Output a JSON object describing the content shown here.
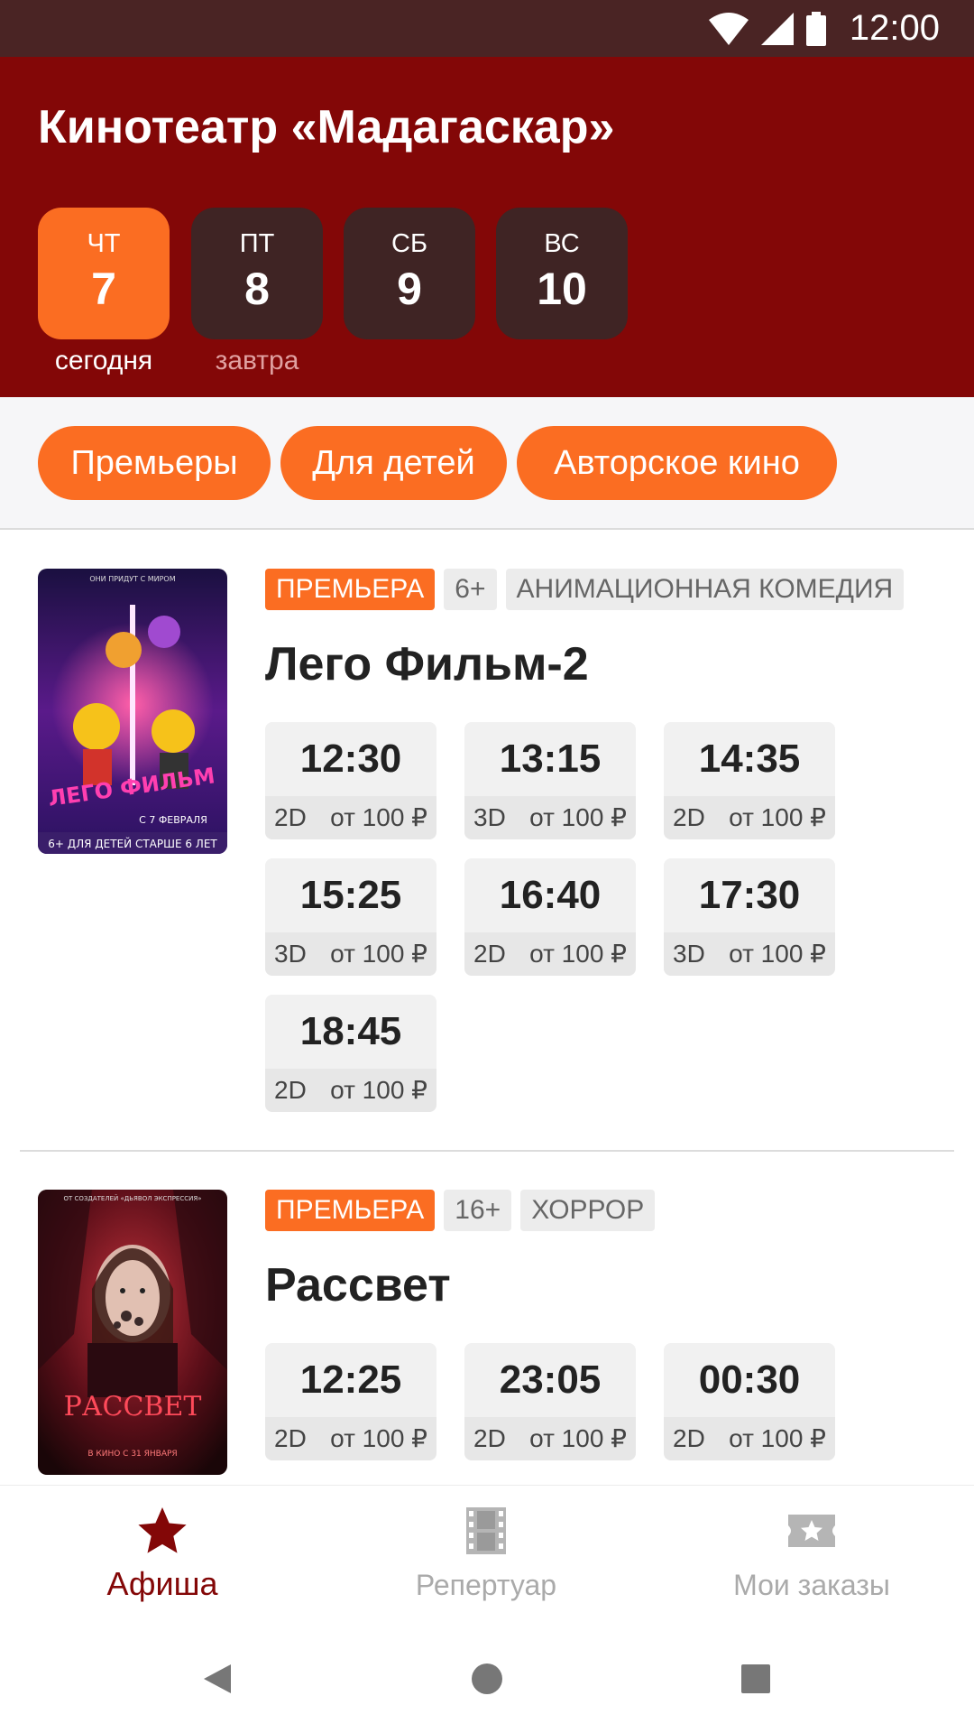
{
  "status_bar": {
    "time": "12:00",
    "icons": [
      "wifi-icon",
      "signal-icon",
      "battery-icon"
    ]
  },
  "header": {
    "title": "Кинотеатр «Мадагаскар»"
  },
  "days": [
    {
      "dow": "ЧТ",
      "num": "7",
      "caption": "сегодня",
      "active": true
    },
    {
      "dow": "ПТ",
      "num": "8",
      "caption": "завтра",
      "active": false
    },
    {
      "dow": "СБ",
      "num": "9",
      "caption": "",
      "active": false
    },
    {
      "dow": "ВС",
      "num": "10",
      "caption": "",
      "active": false
    }
  ],
  "filters": [
    "Премьеры",
    "Для детей",
    "Авторское кино"
  ],
  "movies": [
    {
      "tags": [
        "ПРЕМЬЕРА",
        "6+",
        "АНИМАЦИОННАЯ КОМЕДИЯ"
      ],
      "title": "Лего Фильм-2",
      "poster": {
        "top_text": "ОНИ ПРИДУТ С МИРОМ",
        "main_text": "ЛЕГО ФИЛЬМ",
        "date_text": "С 7 ФЕВРАЛЯ",
        "footer_text": "6+ ДЛЯ ДЕТЕЙ СТАРШЕ 6 ЛЕТ"
      },
      "sessions": [
        {
          "time": "12:30",
          "format": "2D",
          "price": "от 100 ₽"
        },
        {
          "time": "13:15",
          "format": "3D",
          "price": "от 100 ₽"
        },
        {
          "time": "14:35",
          "format": "2D",
          "price": "от 100 ₽"
        },
        {
          "time": "15:25",
          "format": "3D",
          "price": "от 100 ₽"
        },
        {
          "time": "16:40",
          "format": "2D",
          "price": "от 100 ₽"
        },
        {
          "time": "17:30",
          "format": "3D",
          "price": "от 100 ₽"
        },
        {
          "time": "18:45",
          "format": "2D",
          "price": "от 100 ₽"
        }
      ]
    },
    {
      "tags": [
        "ПРЕМЬЕРА",
        "16+",
        "ХОРРОР"
      ],
      "title": "Рассвет",
      "poster": {
        "top_text": "ОТ СОЗДАТЕЛЕЙ «ДЬЯВОЛ ЭКСПРЕССИЯ»",
        "main_text": "РАССВЕТ",
        "date_text": "В КИНО С 31 ЯНВАРЯ",
        "footer_text": ""
      },
      "sessions": [
        {
          "time": "12:25",
          "format": "2D",
          "price": "от 100 ₽"
        },
        {
          "time": "23:05",
          "format": "2D",
          "price": "от 100 ₽"
        },
        {
          "time": "00:30",
          "format": "2D",
          "price": "от 100 ₽"
        }
      ]
    }
  ],
  "bottom_nav": [
    {
      "label": "Афиша",
      "icon": "star-icon",
      "active": true
    },
    {
      "label": "Репертуар",
      "icon": "film-icon",
      "active": false
    },
    {
      "label": "Мои заказы",
      "icon": "ticket-icon",
      "active": false
    }
  ],
  "colors": {
    "header": "#830707",
    "accent": "#fb6d22",
    "status_bar": "#4a2424",
    "chip_dark": "#3f2424"
  }
}
